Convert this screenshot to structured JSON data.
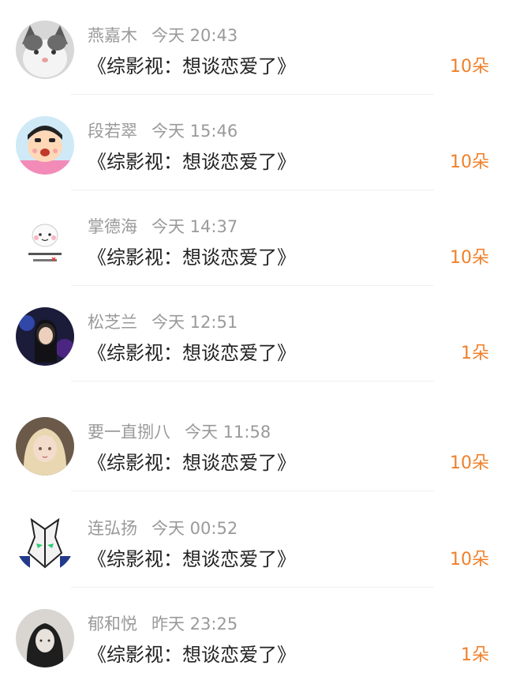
{
  "comments": [
    {
      "name": "燕嘉木",
      "time": "今天 20:43",
      "content": "《综影视：想谈恋爱了》",
      "gift": "10朵",
      "avatar": "cat-avatar-icon"
    },
    {
      "name": "段若翠",
      "time": "今天 15:46",
      "content": "《综影视：想谈恋爱了》",
      "gift": "10朵",
      "avatar": "crayon-shin-avatar-icon"
    },
    {
      "name": "掌德海",
      "time": "今天 14:37",
      "content": "《综影视：想谈恋爱了》",
      "gift": "10朵",
      "avatar": "cartoon-figure-avatar-icon"
    },
    {
      "name": "松芝兰",
      "time": "今天 12:51",
      "content": "《综影视：想谈恋爱了》",
      "gift": "1朵",
      "avatar": "girl-photo-avatar-icon"
    },
    {
      "name": "要一直捌八",
      "time": "今天 11:58",
      "content": "《综影视：想谈恋爱了》",
      "gift": "10朵",
      "avatar": "anime-girl-avatar-icon"
    },
    {
      "name": "连弘扬",
      "time": "今天 00:52",
      "content": "《综影视：想谈恋爱了》",
      "gift": "10朵",
      "avatar": "robot-avatar-icon"
    },
    {
      "name": "郁和悦",
      "time": "昨天 23:25",
      "content": "《综影视：想谈恋爱了》",
      "gift": "1朵",
      "avatar": "bw-girl-avatar-icon"
    }
  ],
  "colors": {
    "name_gray": "#9a9a9a",
    "content_text": "#222222",
    "gift_orange": "#f0802a",
    "divider": "#f0f0f0"
  }
}
